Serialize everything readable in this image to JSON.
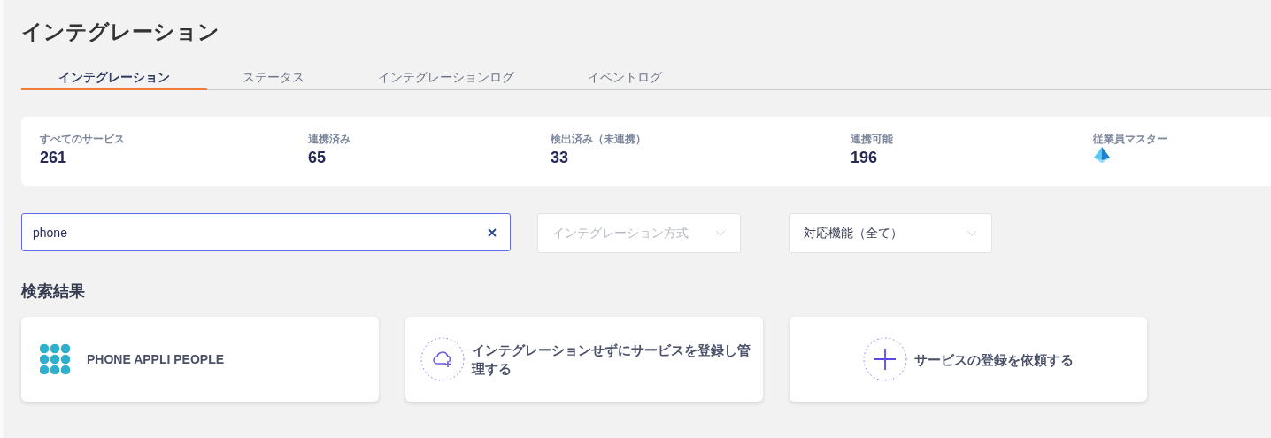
{
  "page_title": "インテグレーション",
  "tabs": [
    {
      "label": "インテグレーション",
      "selected": true
    },
    {
      "label": "ステータス",
      "selected": false
    },
    {
      "label": "インテグレーションログ",
      "selected": false
    },
    {
      "label": "イベントログ",
      "selected": false
    }
  ],
  "stats": [
    {
      "kind": "count",
      "label": "すべてのサービス",
      "value": "261"
    },
    {
      "kind": "count",
      "label": "連携済み",
      "value": "65"
    },
    {
      "kind": "count",
      "label": "検出済み（未連携）",
      "value": "33"
    },
    {
      "kind": "count",
      "label": "連携可能",
      "value": "196"
    },
    {
      "kind": "icon",
      "label": "従業員マスター"
    }
  ],
  "search": {
    "value": "phone"
  },
  "filters": [
    {
      "placeholder": "インテグレーション方式"
    },
    {
      "value": "対応機能（全て）"
    }
  ],
  "results_heading": "検索結果",
  "results": [
    {
      "kind": "service",
      "label": "PHONE APPLI PEOPLE"
    },
    {
      "kind": "register",
      "label": "インテグレーションせずにサービスを登録し管理する"
    },
    {
      "kind": "request",
      "label": "サービスの登録を依頼する"
    }
  ]
}
